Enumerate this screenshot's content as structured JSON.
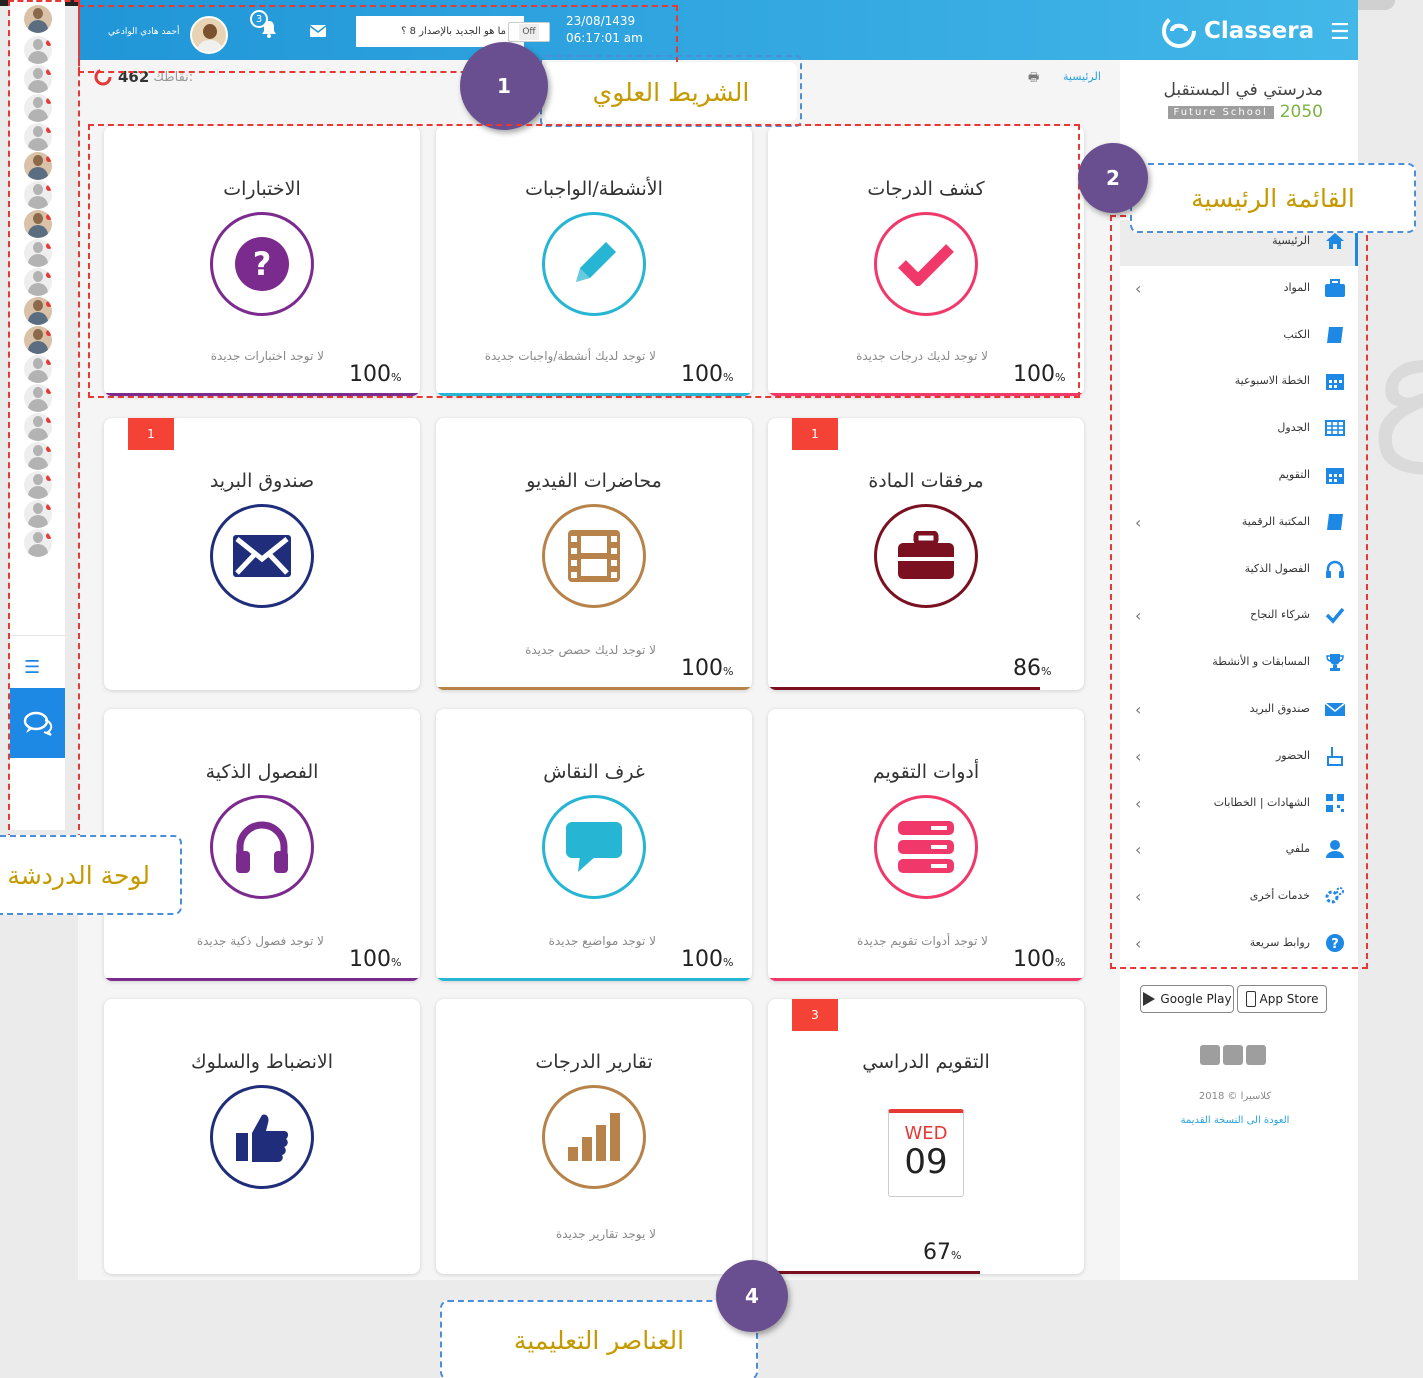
{
  "topbar": {
    "user_name": "أحمد هادي الوادعي",
    "notification_count": "3",
    "whats_new": "ما هو الجديد بالإصدار 8 ؟",
    "toggle_label": "Off",
    "date": "23/08/1439",
    "time": "06:17:01 am",
    "brand": "Classera"
  },
  "header": {
    "points_label": "نقاطك:",
    "points_value": "462",
    "breadcrumb": "الرئيسية"
  },
  "school": {
    "name_ar": "مدرستي في المستقبل",
    "name_en": "Future School",
    "year": "2050"
  },
  "cards": [
    {
      "title": "كشف الدرجات",
      "note": "لا توجد لديك درجات جديدة",
      "percent": "100",
      "color": "#f0396a",
      "icon": "check-icon",
      "badge": ""
    },
    {
      "title": "الأنشطة/الواجبات",
      "note": "لا توجد لديك أنشطة/واجبات جديدة",
      "percent": "100",
      "color": "#26b5d3",
      "icon": "pencil-icon",
      "badge": ""
    },
    {
      "title": "الاختبارات",
      "note": "لا توجد اختبارات جديدة",
      "percent": "100",
      "color": "#7b2a8e",
      "icon": "question-icon",
      "badge": ""
    },
    {
      "title": "مرفقات المادة",
      "note": "",
      "percent": "86",
      "color": "#7a1020",
      "icon": "briefcase-icon",
      "badge": "1"
    },
    {
      "title": "محاضرات الفيديو",
      "note": "لا توجد لديك حصص جديدة",
      "percent": "100",
      "color": "#b7834a",
      "icon": "film-icon",
      "badge": ""
    },
    {
      "title": "صندوق البريد",
      "note": "",
      "percent": "",
      "color": "#1f2d7a",
      "icon": "envelope-icon",
      "badge": "1"
    },
    {
      "title": "أدوات التقويم",
      "note": "لا توجد أدوات تقويم جديدة",
      "percent": "100",
      "color": "#f0396a",
      "icon": "server-icon",
      "badge": ""
    },
    {
      "title": "غرف النقاش",
      "note": "لا توجد مواضيع جديدة",
      "percent": "100",
      "color": "#26b5d3",
      "icon": "comment-icon",
      "badge": ""
    },
    {
      "title": "الفصول الذكية",
      "note": "لا توجد فصول ذكية جديدة",
      "percent": "100",
      "color": "#7b2a8e",
      "icon": "headphones-icon",
      "badge": ""
    },
    {
      "title": "التقويم الدراسي",
      "note": "",
      "percent": "67",
      "color": "#7a1020",
      "icon": "calendar-icon",
      "badge": "3",
      "cal_day": "WED",
      "cal_date": "09"
    },
    {
      "title": "تقارير الدرجات",
      "note": "لا يوجد تقارير جديدة",
      "percent": "",
      "color": "#b7834a",
      "icon": "bar-chart-icon",
      "badge": ""
    },
    {
      "title": "الانضباط والسلوك",
      "note": "",
      "percent": "",
      "color": "#1f2d7a",
      "icon": "thumbs-up-icon",
      "badge": ""
    }
  ],
  "menu": [
    {
      "label": "الرئيسية",
      "icon": "home-icon",
      "chevron": false
    },
    {
      "label": "المواد",
      "icon": "briefcase-icon",
      "chevron": true
    },
    {
      "label": "الكتب",
      "icon": "book-icon",
      "chevron": false
    },
    {
      "label": "الخطة الاسبوعية",
      "icon": "calendar-icon",
      "chevron": false
    },
    {
      "label": "الجدول",
      "icon": "table-icon",
      "chevron": false
    },
    {
      "label": "التقويم",
      "icon": "calendar-icon",
      "chevron": false
    },
    {
      "label": "المكتبة الرقمية",
      "icon": "book-icon",
      "chevron": true
    },
    {
      "label": "الفصول الذكية",
      "icon": "headphones-icon",
      "chevron": false
    },
    {
      "label": "شركاء النجاح",
      "icon": "check-icon",
      "chevron": true
    },
    {
      "label": "المسابقات و الأنشطة",
      "icon": "trophy-icon",
      "chevron": false
    },
    {
      "label": "صندوق البريد",
      "icon": "envelope-icon",
      "chevron": true
    },
    {
      "label": "الحضور",
      "icon": "hand-icon",
      "chevron": true
    },
    {
      "label": "الشهادات | الخطابات",
      "icon": "qr-icon",
      "chevron": true
    },
    {
      "label": "ملفي",
      "icon": "user-icon",
      "chevron": true
    },
    {
      "label": "خدمات أخرى",
      "icon": "gears-icon",
      "chevron": true
    },
    {
      "label": "روابط سريعة",
      "icon": "help-icon",
      "chevron": true
    }
  ],
  "stores": {
    "google_play": "Google Play",
    "app_store": "App Store"
  },
  "footer": {
    "copyright": "كلاسيرا © 2018",
    "old_version": "العودة الى النسخة القديمة"
  },
  "annotations": {
    "top_bar": "الشريط العلوي",
    "main_menu": "القائمة الرئيسية",
    "chat_panel": "لوحة الدردشة",
    "elements": "العناصر التعليمية",
    "n1": "1",
    "n2": "2",
    "n4": "4"
  }
}
